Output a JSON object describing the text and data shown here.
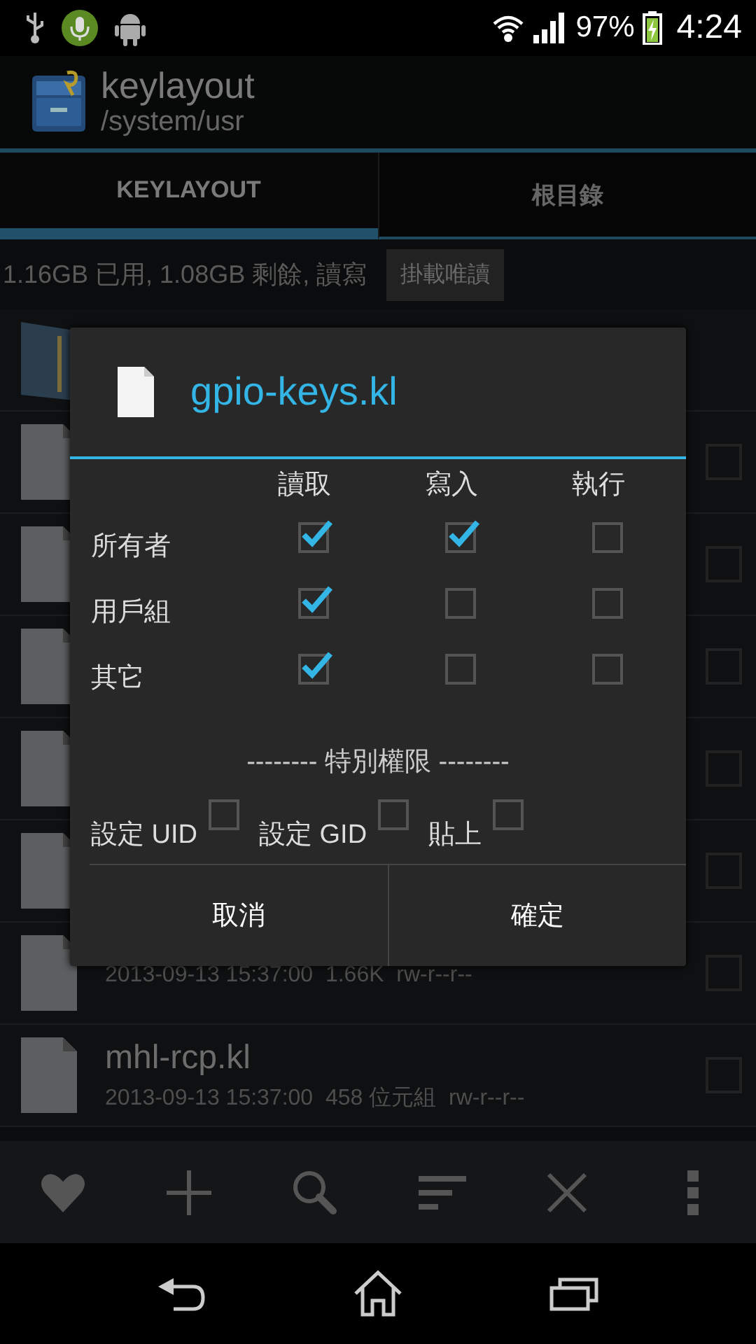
{
  "status_bar": {
    "battery": "97%",
    "time": "4:24"
  },
  "action_bar": {
    "title": "keylayout",
    "subtitle": "/system/usr"
  },
  "tabs": [
    {
      "label": "KEYLAYOUT",
      "selected": true
    },
    {
      "label": "根目錄",
      "selected": false
    }
  ],
  "storage": {
    "text": "1.16GB 已用, 1.08GB 剩餘, 讀寫",
    "button": "掛載唯讀"
  },
  "files": [
    {
      "kind": "folder"
    },
    {
      "kind": "file",
      "checked": false
    },
    {
      "kind": "file",
      "checked": false
    },
    {
      "kind": "file",
      "checked": false
    },
    {
      "kind": "file",
      "checked": false
    },
    {
      "kind": "file",
      "checked": false
    },
    {
      "kind": "file",
      "details": "2013-09-13 15:37:00  1.66K  rw-r--r--",
      "checked": false
    },
    {
      "kind": "file",
      "name": "mhl-rcp.kl",
      "details": "2013-09-13 15:37:00  458 位元組  rw-r--r--",
      "checked": false
    }
  ],
  "dialog": {
    "title": "gpio-keys.kl",
    "columns": [
      "讀取",
      "寫入",
      "執行"
    ],
    "rows": [
      {
        "label": "所有者",
        "perms": [
          true,
          true,
          false
        ]
      },
      {
        "label": "用戶組",
        "perms": [
          true,
          false,
          false
        ]
      },
      {
        "label": "其它",
        "perms": [
          true,
          false,
          false
        ]
      }
    ],
    "special_heading": "-------- 特別權限 --------",
    "special": [
      {
        "label": "設定 UID",
        "checked": false
      },
      {
        "label": "設定 GID",
        "checked": false
      },
      {
        "label": "貼上",
        "checked": false
      }
    ],
    "buttons": [
      "取消",
      "確定"
    ]
  }
}
